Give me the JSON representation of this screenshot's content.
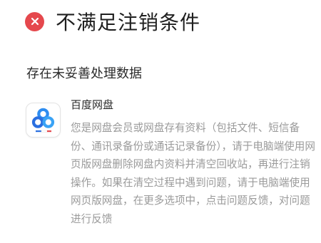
{
  "header": {
    "status_icon": "close-icon",
    "status_color": "#e5484d",
    "title": "不满足注销条件"
  },
  "section": {
    "title": "存在未妥善处理数据"
  },
  "app": {
    "icon": "baidu-netdisk-icon",
    "name": "百度网盘",
    "description": "您是网盘会员或网盘存有资料（包括文件、短信备份、通讯录备份或通话记录备份），请于电脑端使用网页版网盘删除网盘内资料并清空回收站，再进行注销操作。如果在清空过程中遇到问题，请于电脑端使用网页版网盘，在更多选项中，点击问题反馈，对问题进行反馈"
  }
}
